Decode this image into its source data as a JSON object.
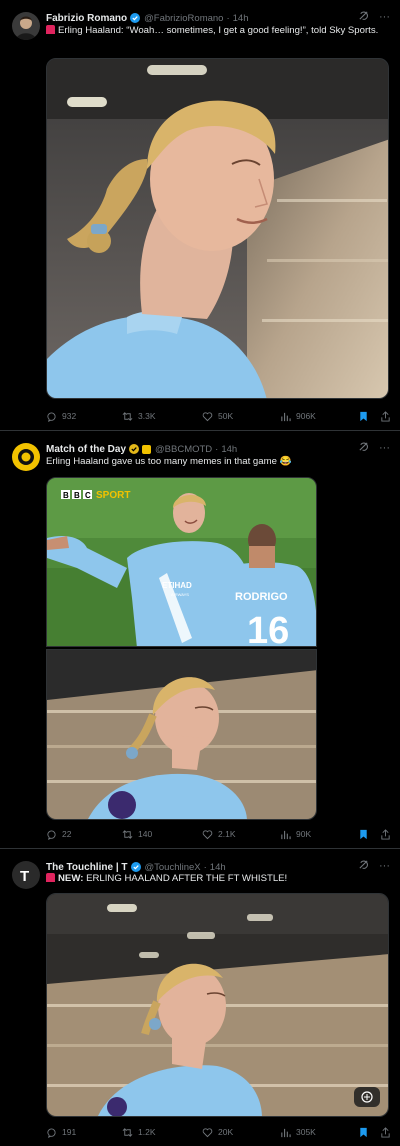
{
  "tweets": [
    {
      "name": "Fabrizio Romano",
      "handle": "@FabrizioRomano",
      "time": "14h",
      "text": "Erling Haaland: “Woah… sometimes, I get a good feeling!”, told Sky Sports.",
      "replies": "932",
      "retweets": "3.3K",
      "likes": "50K",
      "views": "906K"
    },
    {
      "name": "Match of the Day",
      "handle": "@BBCMOTD",
      "time": "14h",
      "text": "Erling Haaland gave us too many memes in that game 😂",
      "media_label": "BBC SPORT",
      "replies": "22",
      "retweets": "140",
      "likes": "2.1K",
      "views": "90K"
    },
    {
      "name": "The Touchline | T",
      "handle": "@TouchlineX",
      "time": "14h",
      "text_bold": "NEW:",
      "text": "ERLING HAALAND AFTER THE FT WHISTLE!",
      "replies": "191",
      "retweets": "1.2K",
      "likes": "20K",
      "views": "305K"
    }
  ],
  "jersey": {
    "sponsor": "ETIHAD",
    "sponsor_sub": "AIRWAYS",
    "name": "RODRIGO",
    "number": "16"
  },
  "colors": {
    "background": "#000000",
    "text": "#e7e9ea",
    "muted": "#71767b",
    "verified": "#1d9bf0",
    "accent_blue": "#1d9bf0",
    "gold": "#e2b719",
    "city_blue": "#8ec6ec"
  }
}
